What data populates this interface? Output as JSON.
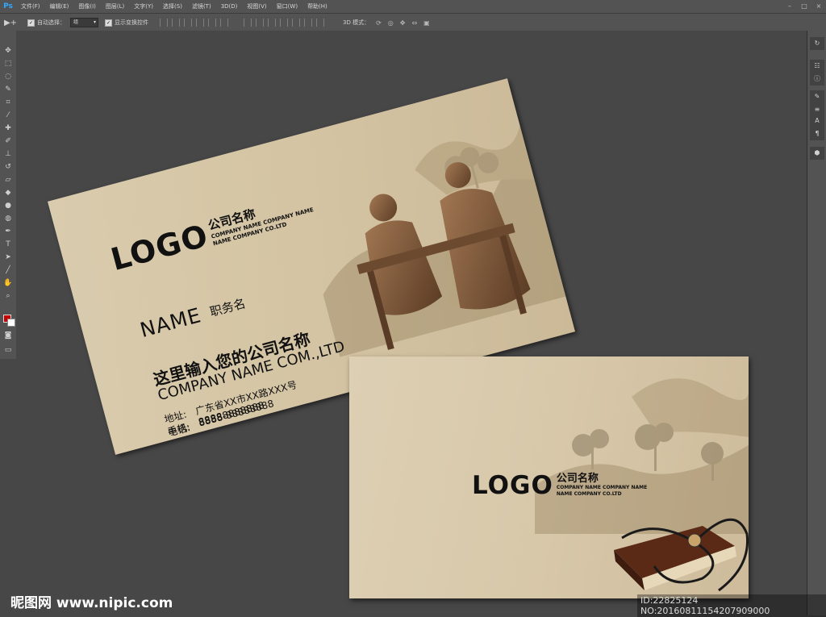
{
  "app": {
    "logo": "Ps"
  },
  "menu": {
    "items": [
      "文件(F)",
      "编辑(E)",
      "图像(I)",
      "图层(L)",
      "文字(Y)",
      "选择(S)",
      "滤镜(T)",
      "3D(D)",
      "视图(V)",
      "窗口(W)",
      "帮助(H)"
    ],
    "window_controls": [
      "–",
      "□",
      "×"
    ]
  },
  "options": {
    "tool_glyph": "▶+",
    "auto_select_label": "自动选择：",
    "auto_select_value": "组",
    "show_transform_label": "显示变换控件",
    "mode3d_label": "3D 模式："
  },
  "card_front": {
    "logo": "LOGO",
    "company_cn": "公司名称",
    "company_en_1": "COMPANY NAME COMPANY NAME",
    "company_en_2": "NAME COMPANY CO.LTD",
    "name": "NAME",
    "title": "职务名",
    "company_full_cn": "这里输入您的公司名称",
    "company_full_en": "COMPANY NAME COM.,LTD",
    "contacts": [
      {
        "label": "地址:",
        "value": "广东省XX市XX路XXX号"
      },
      {
        "label": "电话:",
        "value": "8888-88888888"
      },
      {
        "label": "手机:",
        "value": "88888888888"
      }
    ]
  },
  "card_back": {
    "logo": "LOGO",
    "company_cn": "公司名称",
    "company_en_1": "COMPANY NAME COMPANY NAME",
    "company_en_2": "NAME COMPANY CO.LTD"
  },
  "watermark": {
    "site": "昵图网 www.nipic.com",
    "id": "ID:22825124 NO:20160811154207909000"
  }
}
